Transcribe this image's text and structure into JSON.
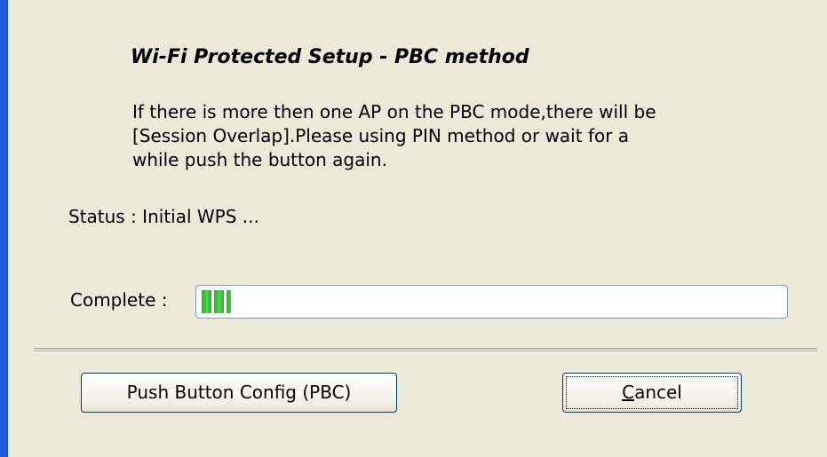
{
  "dialog": {
    "title": "Wi-Fi Protected Setup - PBC method",
    "description": [
      "If there is more then one AP on the PBC mode,there will be",
      "[Session Overlap].Please using PIN method or wait for a",
      "while push the button again."
    ],
    "status_text": "Status : Initial WPS ...",
    "complete_label": "Complete :",
    "progress_fraction": 0.05
  },
  "buttons": {
    "pbc_label": "Push Button Config (PBC)",
    "cancel_mnemonic": "C",
    "cancel_rest": "ancel"
  },
  "colors": {
    "window_bg": "#ece9d8",
    "accent_border": "#1c5ad8",
    "progress_green": "#2ab12a"
  }
}
